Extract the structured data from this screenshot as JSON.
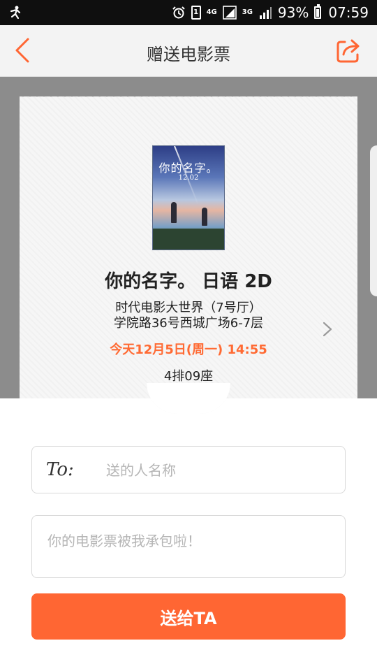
{
  "status_bar": {
    "network_1": "4G",
    "network_2": "3G",
    "sim_badge": "1",
    "battery": "93%",
    "time": "07:59",
    "icons": [
      "stickman-icon",
      "alarm-icon",
      "sim-icon",
      "signal-icon",
      "signal-icon",
      "battery-icon"
    ]
  },
  "appbar": {
    "title": "赠送电影票",
    "icons": {
      "back": "chevron-left-icon",
      "share": "share-icon"
    }
  },
  "ticket": {
    "poster": {
      "title": "你的名字。",
      "date": "12.02"
    },
    "movie_title": "你的名字。 日语 2D",
    "cinema_name": "时代电影大世界（7号厅）",
    "cinema_address": "学院路36号西城广场6-7层",
    "showtime": "今天12月5日(周一) 14:55",
    "seat": "4排09座"
  },
  "form": {
    "to_label": "To:",
    "to_placeholder": "送的人名称",
    "message_placeholder": "你的电影票被我承包啦！",
    "send_label": "送给TA"
  },
  "colors": {
    "accent": "#ff6633",
    "showtime": "#ff6a33",
    "backdrop": "#8c8c8c"
  }
}
